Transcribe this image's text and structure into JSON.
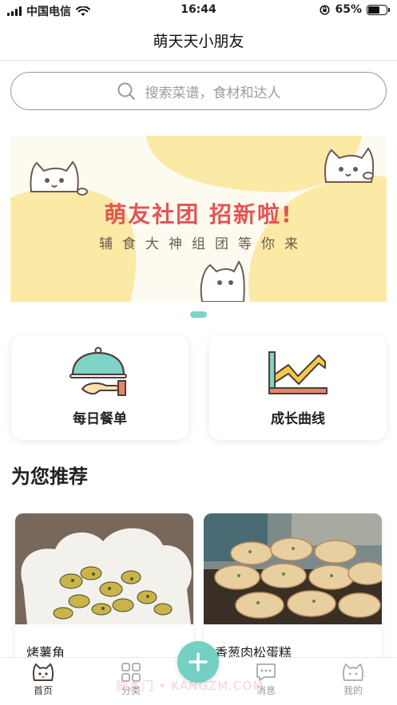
{
  "status_bar": {
    "carrier": "中国电信",
    "time": "16:44",
    "battery": "65%",
    "battery_level": 0.65,
    "icons": [
      "signal-icon",
      "wifi-icon",
      "orientation-lock-icon",
      "battery-icon"
    ]
  },
  "nav": {
    "title": "萌天天小朋友"
  },
  "search": {
    "placeholder": "搜索菜谱，食材和达人",
    "icon": "search-icon"
  },
  "banner": {
    "title": "萌友社团 招新啦!",
    "subtitle": "辅食大神组团等你来",
    "page_index": 1,
    "page_count": 1
  },
  "quick_actions": [
    {
      "label": "每日餐单",
      "icon": "cloche-dish-icon"
    },
    {
      "label": "成长曲线",
      "icon": "growth-chart-icon"
    }
  ],
  "recommend": {
    "title": "为您推荐",
    "items": [
      {
        "name": "烤薯角",
        "image": "roasted-potato-wedges-photo"
      },
      {
        "name": "香葱肉松蛋糕",
        "image": "scallion-pork-floss-cake-photo"
      }
    ]
  },
  "tab_bar": {
    "tabs": [
      {
        "label": "首页",
        "icon": "cat-face-icon",
        "active": true
      },
      {
        "label": "分类",
        "icon": "grid-icon",
        "active": false
      },
      {
        "label": "消息",
        "icon": "chat-bubble-icon",
        "active": false
      },
      {
        "label": "我的",
        "icon": "cat-outline-icon",
        "active": false
      }
    ],
    "fab_icon": "plus-icon"
  },
  "watermark": "脚本门 • KANGZM.COM",
  "colors": {
    "accent": "#73d0c3",
    "banner_red": "#e35454",
    "banner_yellow": "#fbe9a6",
    "text_dark": "#222222",
    "placeholder": "#9c9c9c"
  }
}
